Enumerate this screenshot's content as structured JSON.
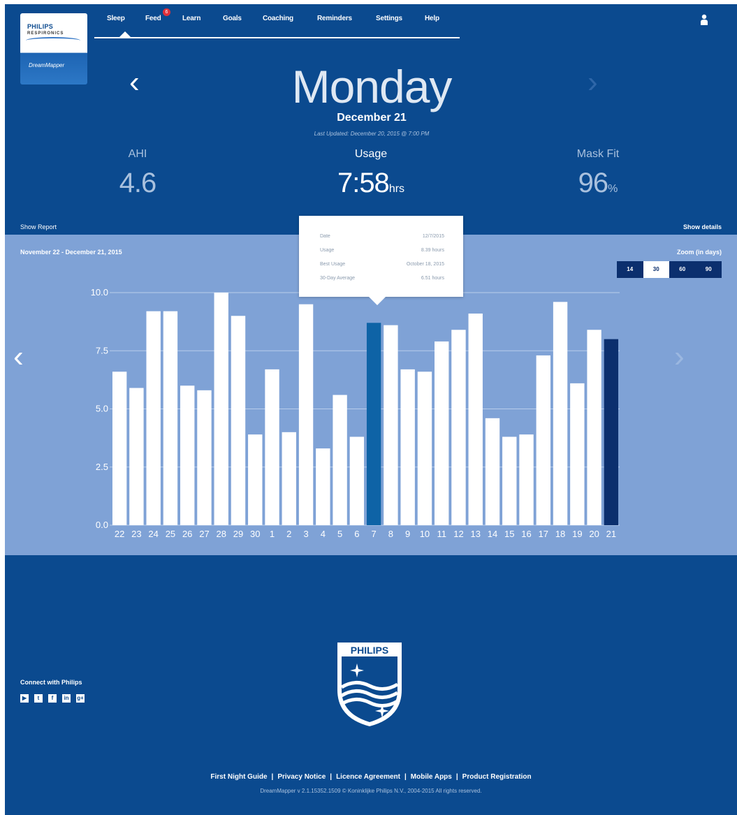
{
  "logo": {
    "brand": "PHILIPS",
    "sub": "RESPIRONICS",
    "app": "DreamMapper"
  },
  "nav": {
    "items": [
      {
        "label": "Sleep"
      },
      {
        "label": "Feed"
      },
      {
        "label": "Learn"
      },
      {
        "label": "Goals"
      },
      {
        "label": "Coaching"
      },
      {
        "label": "Reminders"
      },
      {
        "label": "Settings"
      },
      {
        "label": "Help"
      }
    ],
    "feed_badge": "6"
  },
  "day": {
    "prev": "‹",
    "next": "›",
    "title": "Monday",
    "date": "December 21",
    "updated": "Last Updated: December 20, 2015 @ 7:00 PM"
  },
  "metrics": {
    "ahi": {
      "label": "AHI",
      "value": "4.6"
    },
    "usage": {
      "label": "Usage",
      "value": "7:58",
      "unit": "hrs"
    },
    "mask": {
      "label": "Mask Fit",
      "value": "96",
      "unit": "%"
    }
  },
  "links": {
    "show_report": "Show Report",
    "show_details": "Show details"
  },
  "chart_header": {
    "range": "November 22 - December 21, 2015",
    "zoom_label": "Zoom (in days)",
    "zoom_options": [
      "14",
      "30",
      "60",
      "90"
    ],
    "zoom_selected": "30"
  },
  "tooltip": {
    "rows": [
      {
        "label": "Date",
        "value": "12/7/2015"
      },
      {
        "label": "Usage",
        "value": "8.39 hours"
      },
      {
        "label": "Best Usage",
        "value": "October 18, 2015"
      },
      {
        "label": "30-Day Average",
        "value": "6.51 hours"
      }
    ]
  },
  "chart_data": {
    "type": "bar",
    "categories": [
      "22",
      "23",
      "24",
      "25",
      "26",
      "27",
      "28",
      "29",
      "30",
      "1",
      "2",
      "3",
      "4",
      "5",
      "6",
      "7",
      "8",
      "9",
      "10",
      "11",
      "12",
      "13",
      "14",
      "15",
      "16",
      "17",
      "18",
      "19",
      "20",
      "21"
    ],
    "values": [
      6.6,
      5.9,
      9.2,
      9.2,
      6.0,
      5.8,
      10.0,
      9.0,
      3.9,
      6.7,
      4.0,
      9.5,
      3.3,
      5.6,
      3.8,
      8.7,
      8.6,
      6.7,
      6.6,
      7.9,
      8.4,
      9.1,
      4.6,
      3.8,
      3.9,
      7.3,
      9.6,
      6.1,
      8.4,
      8.0
    ],
    "yticks": [
      "10.0",
      "7.5",
      "5.0",
      "2.5",
      "0.0"
    ],
    "ylim": [
      0,
      10
    ],
    "grid": true,
    "highlighted_index": 15,
    "current_index": 29,
    "colors": {
      "bar": "#ffffff",
      "highlighted": "#0e63a6",
      "current": "#0b2f6e",
      "grid": "#b8cdeb"
    }
  },
  "footer": {
    "connect": "Connect with Philips",
    "social": [
      {
        "icon": "youtube-icon",
        "glyph": "▶"
      },
      {
        "icon": "twitter-icon",
        "glyph": "t"
      },
      {
        "icon": "facebook-icon",
        "glyph": "f"
      },
      {
        "icon": "linkedin-icon",
        "glyph": "in"
      },
      {
        "icon": "google-plus-icon",
        "glyph": "g+"
      }
    ],
    "philips_logo": "PHILIPS",
    "links": [
      "First Night Guide",
      "Privacy Notice",
      "Licence Agreement",
      "Mobile Apps",
      "Product Registration"
    ],
    "copyright": "DreamMapper v 2.1.15352.1509 © Koninklijke Philips N.V., 2004-2015 All rights reserved."
  }
}
